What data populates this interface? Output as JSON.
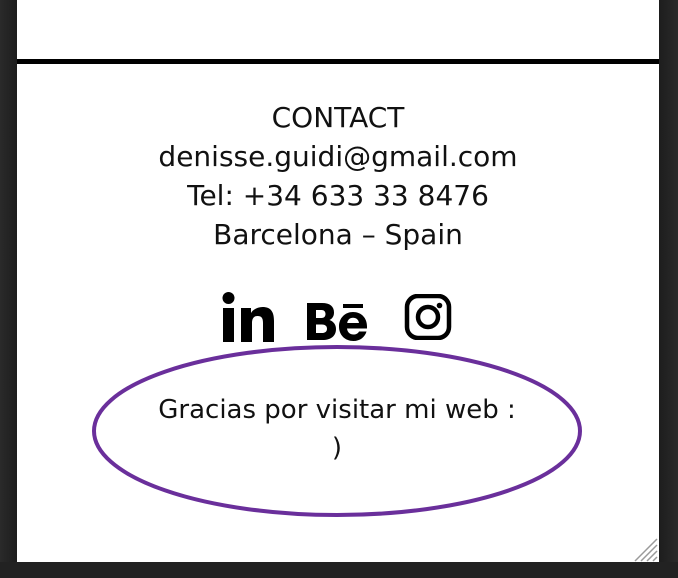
{
  "contact": {
    "heading": "CONTACT",
    "email": "denisse.guidi@gmail.com",
    "phone": "Tel: +34 633 33 8476",
    "location": "Barcelona – Spain"
  },
  "socials": [
    {
      "name": "linkedin-icon"
    },
    {
      "name": "behance-icon"
    },
    {
      "name": "instagram-icon"
    }
  ],
  "thanks": {
    "text_line1": "Gracias por visitar mi web :",
    "text_line2": ")"
  },
  "colors": {
    "ellipse_stroke": "#6a2f9b",
    "divider": "#000000",
    "text": "#111111",
    "frame": "#262626"
  }
}
